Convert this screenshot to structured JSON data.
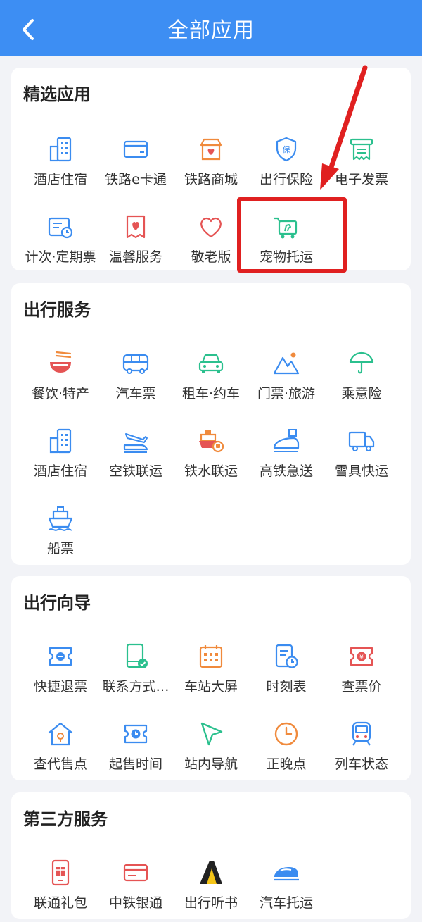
{
  "header": {
    "title": "全部应用",
    "back_icon": "chevron-left-icon"
  },
  "colors": {
    "header": "#3d8ef3",
    "blue": "#3b8cf0",
    "orange": "#f08a3c",
    "red": "#e55454",
    "green": "#2bc08e",
    "highlight": "#e02020"
  },
  "sections": [
    {
      "title": "精选应用",
      "items": [
        {
          "label": "酒店住宿",
          "icon": "hotel-building-icon"
        },
        {
          "label": "铁路e卡通",
          "icon": "card-icon"
        },
        {
          "label": "铁路商城",
          "icon": "shop-icon"
        },
        {
          "label": "出行保险",
          "icon": "insurance-shield-icon"
        },
        {
          "label": "电子发票",
          "icon": "invoice-icon"
        },
        {
          "label": "计次·定期票",
          "icon": "ticket-clock-icon"
        },
        {
          "label": "温馨服务",
          "icon": "heart-card-icon"
        },
        {
          "label": "敬老版",
          "icon": "heart-icon"
        },
        {
          "label": "宠物托运",
          "icon": "pet-cart-icon"
        }
      ]
    },
    {
      "title": "出行服务",
      "items": [
        {
          "label": "餐饮·特产",
          "icon": "noodle-bowl-icon"
        },
        {
          "label": "汽车票",
          "icon": "bus-icon"
        },
        {
          "label": "租车·约车",
          "icon": "car-icon"
        },
        {
          "label": "门票·旅游",
          "icon": "mountain-icon"
        },
        {
          "label": "乘意险",
          "icon": "umbrella-icon"
        },
        {
          "label": "酒店住宿",
          "icon": "hotel-building-icon"
        },
        {
          "label": "空铁联运",
          "icon": "plane-train-icon"
        },
        {
          "label": "铁水联运",
          "icon": "ship-train-icon"
        },
        {
          "label": "高铁急送",
          "icon": "high-speed-train-icon"
        },
        {
          "label": "雪具快运",
          "icon": "truck-icon"
        },
        {
          "label": "船票",
          "icon": "ship-icon"
        }
      ]
    },
    {
      "title": "出行向导",
      "items": [
        {
          "label": "快捷退票",
          "icon": "refund-ticket-icon"
        },
        {
          "label": "联系方式…",
          "icon": "phone-check-icon"
        },
        {
          "label": "车站大屏",
          "icon": "calendar-grid-icon"
        },
        {
          "label": "时刻表",
          "icon": "timetable-icon"
        },
        {
          "label": "查票价",
          "icon": "price-ticket-icon"
        },
        {
          "label": "查代售点",
          "icon": "house-location-icon"
        },
        {
          "label": "起售时间",
          "icon": "ticket-clock-icon"
        },
        {
          "label": "站内导航",
          "icon": "navigation-arrow-icon"
        },
        {
          "label": "正晚点",
          "icon": "clock-icon"
        },
        {
          "label": "列车状态",
          "icon": "train-front-icon"
        }
      ]
    },
    {
      "title": "第三方服务",
      "items": [
        {
          "label": "联通礼包",
          "icon": "phone-gift-icon"
        },
        {
          "label": "中铁银通",
          "icon": "bank-card-icon"
        },
        {
          "label": "出行听书",
          "icon": "audiobook-icon"
        },
        {
          "label": "汽车托运",
          "icon": "car-shipping-icon"
        }
      ]
    }
  ]
}
